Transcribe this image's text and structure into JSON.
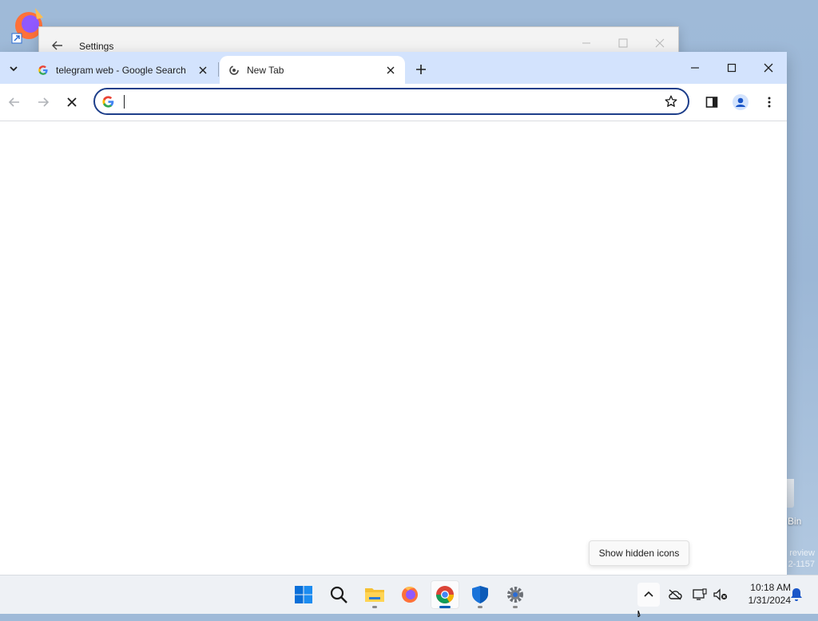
{
  "desktop": {
    "recycle_bin_label": "Bin",
    "watermark_line1": "review",
    "watermark_line2": "2-1157"
  },
  "settings_window": {
    "title": "Settings"
  },
  "browser": {
    "tabs": [
      {
        "title": "telegram web - Google Search",
        "favicon": "google-g-icon",
        "active": false
      },
      {
        "title": "New Tab",
        "favicon": "chrome-loading-icon",
        "active": true
      }
    ],
    "address_bar": {
      "value": "",
      "placeholder": ""
    }
  },
  "tooltip": {
    "text": "Show hidden icons"
  },
  "taskbar": {
    "apps": [
      "start-icon",
      "search-icon",
      "file-explorer-icon",
      "firefox-icon",
      "chrome-icon",
      "defender-icon",
      "settings-icon"
    ],
    "clock": {
      "time": "10:18 AM",
      "date": "1/31/2024"
    }
  },
  "colors": {
    "tabstrip": "#d3e3fd",
    "omnibox_border": "#1d3e8a",
    "taskbar": "#eef1f5",
    "accent": "#005fb8"
  }
}
